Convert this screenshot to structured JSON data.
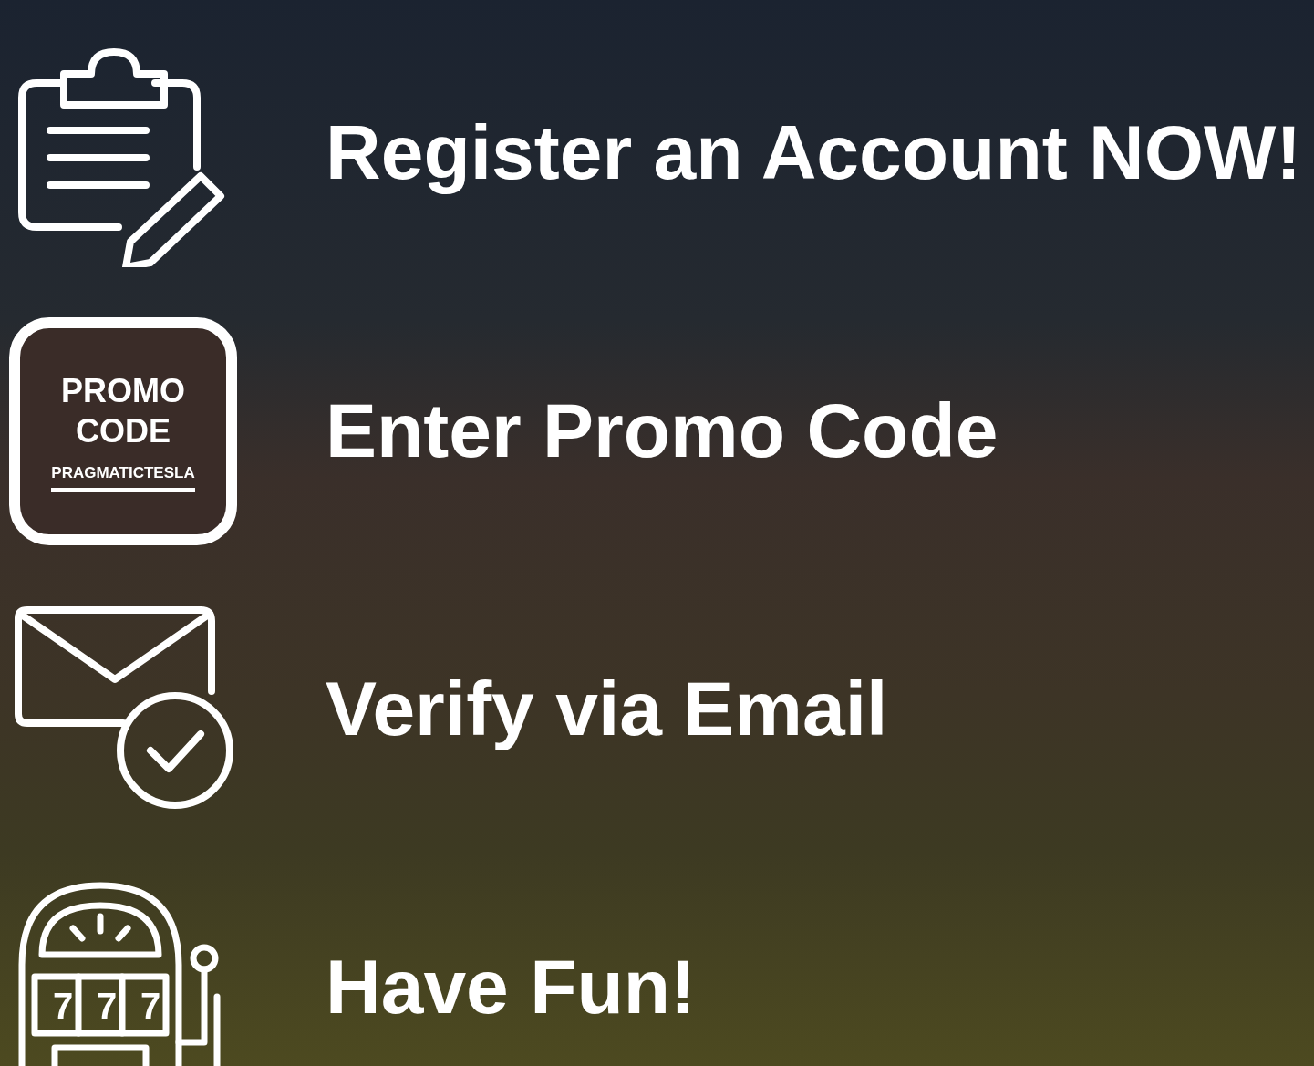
{
  "steps": [
    {
      "kind": "clipboard",
      "title": "Register an Account NOW!"
    },
    {
      "kind": "promo",
      "title": "Enter Promo Code",
      "badge_lines": [
        "PROMO",
        "CODE"
      ],
      "code": "PRAGMATICTESLA"
    },
    {
      "kind": "email",
      "title": "Verify via Email"
    },
    {
      "kind": "slot",
      "title": "Have Fun!",
      "reel_digits": [
        "7",
        "7",
        "7"
      ]
    }
  ]
}
